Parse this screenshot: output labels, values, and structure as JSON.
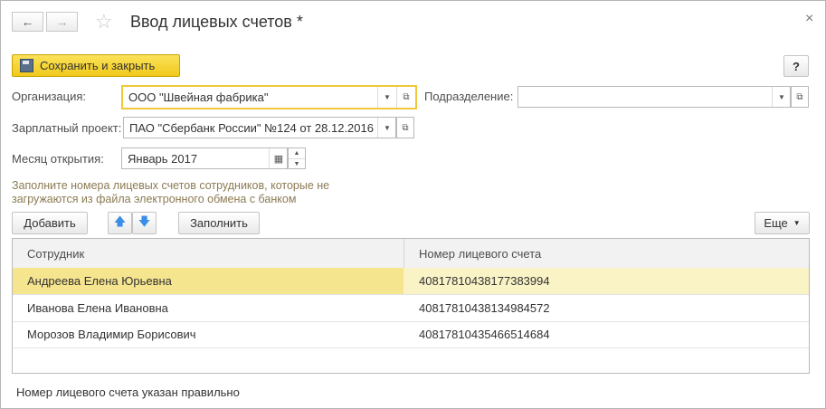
{
  "window": {
    "title": "Ввод лицевых счетов *",
    "close_glyph": "×"
  },
  "toolbar": {
    "save_close_label": "Сохранить и закрыть",
    "help_label": "?"
  },
  "form": {
    "organization": {
      "label": "Организация:",
      "value": "ООО \"Швейная фабрика\""
    },
    "subdivision": {
      "label": "Подразделение:",
      "value": ""
    },
    "salary_project": {
      "label": "Зарплатный проект:",
      "value": "ПАО \"Сбербанк России\" №124 от 28.12.2016"
    },
    "open_month": {
      "label": "Месяц открытия:",
      "value": "Январь 2017"
    }
  },
  "hint": "Заполните номера лицевых счетов сотрудников, которые не загружаются из файла электронного обмена с банком",
  "table_toolbar": {
    "add_label": "Добавить",
    "fill_label": "Заполнить",
    "more_label": "Еще"
  },
  "table": {
    "columns": [
      "Сотрудник",
      "Номер лицевого счета"
    ],
    "rows": [
      {
        "employee": "Андреева Елена Юрьевна",
        "account": "40817810438177383994",
        "selected": true
      },
      {
        "employee": "Иванова Елена Ивановна",
        "account": "40817810438134984572",
        "selected": false
      },
      {
        "employee": "Морозов Владимир Борисович",
        "account": "40817810435466514684",
        "selected": false
      }
    ]
  },
  "status_text": "Номер лицевого счета указан правильно",
  "colors": {
    "primary_button": "#f4d224",
    "selection": "#faf3c6",
    "hint": "#8c7b53",
    "arrow_blue": "#3a8ee6"
  }
}
